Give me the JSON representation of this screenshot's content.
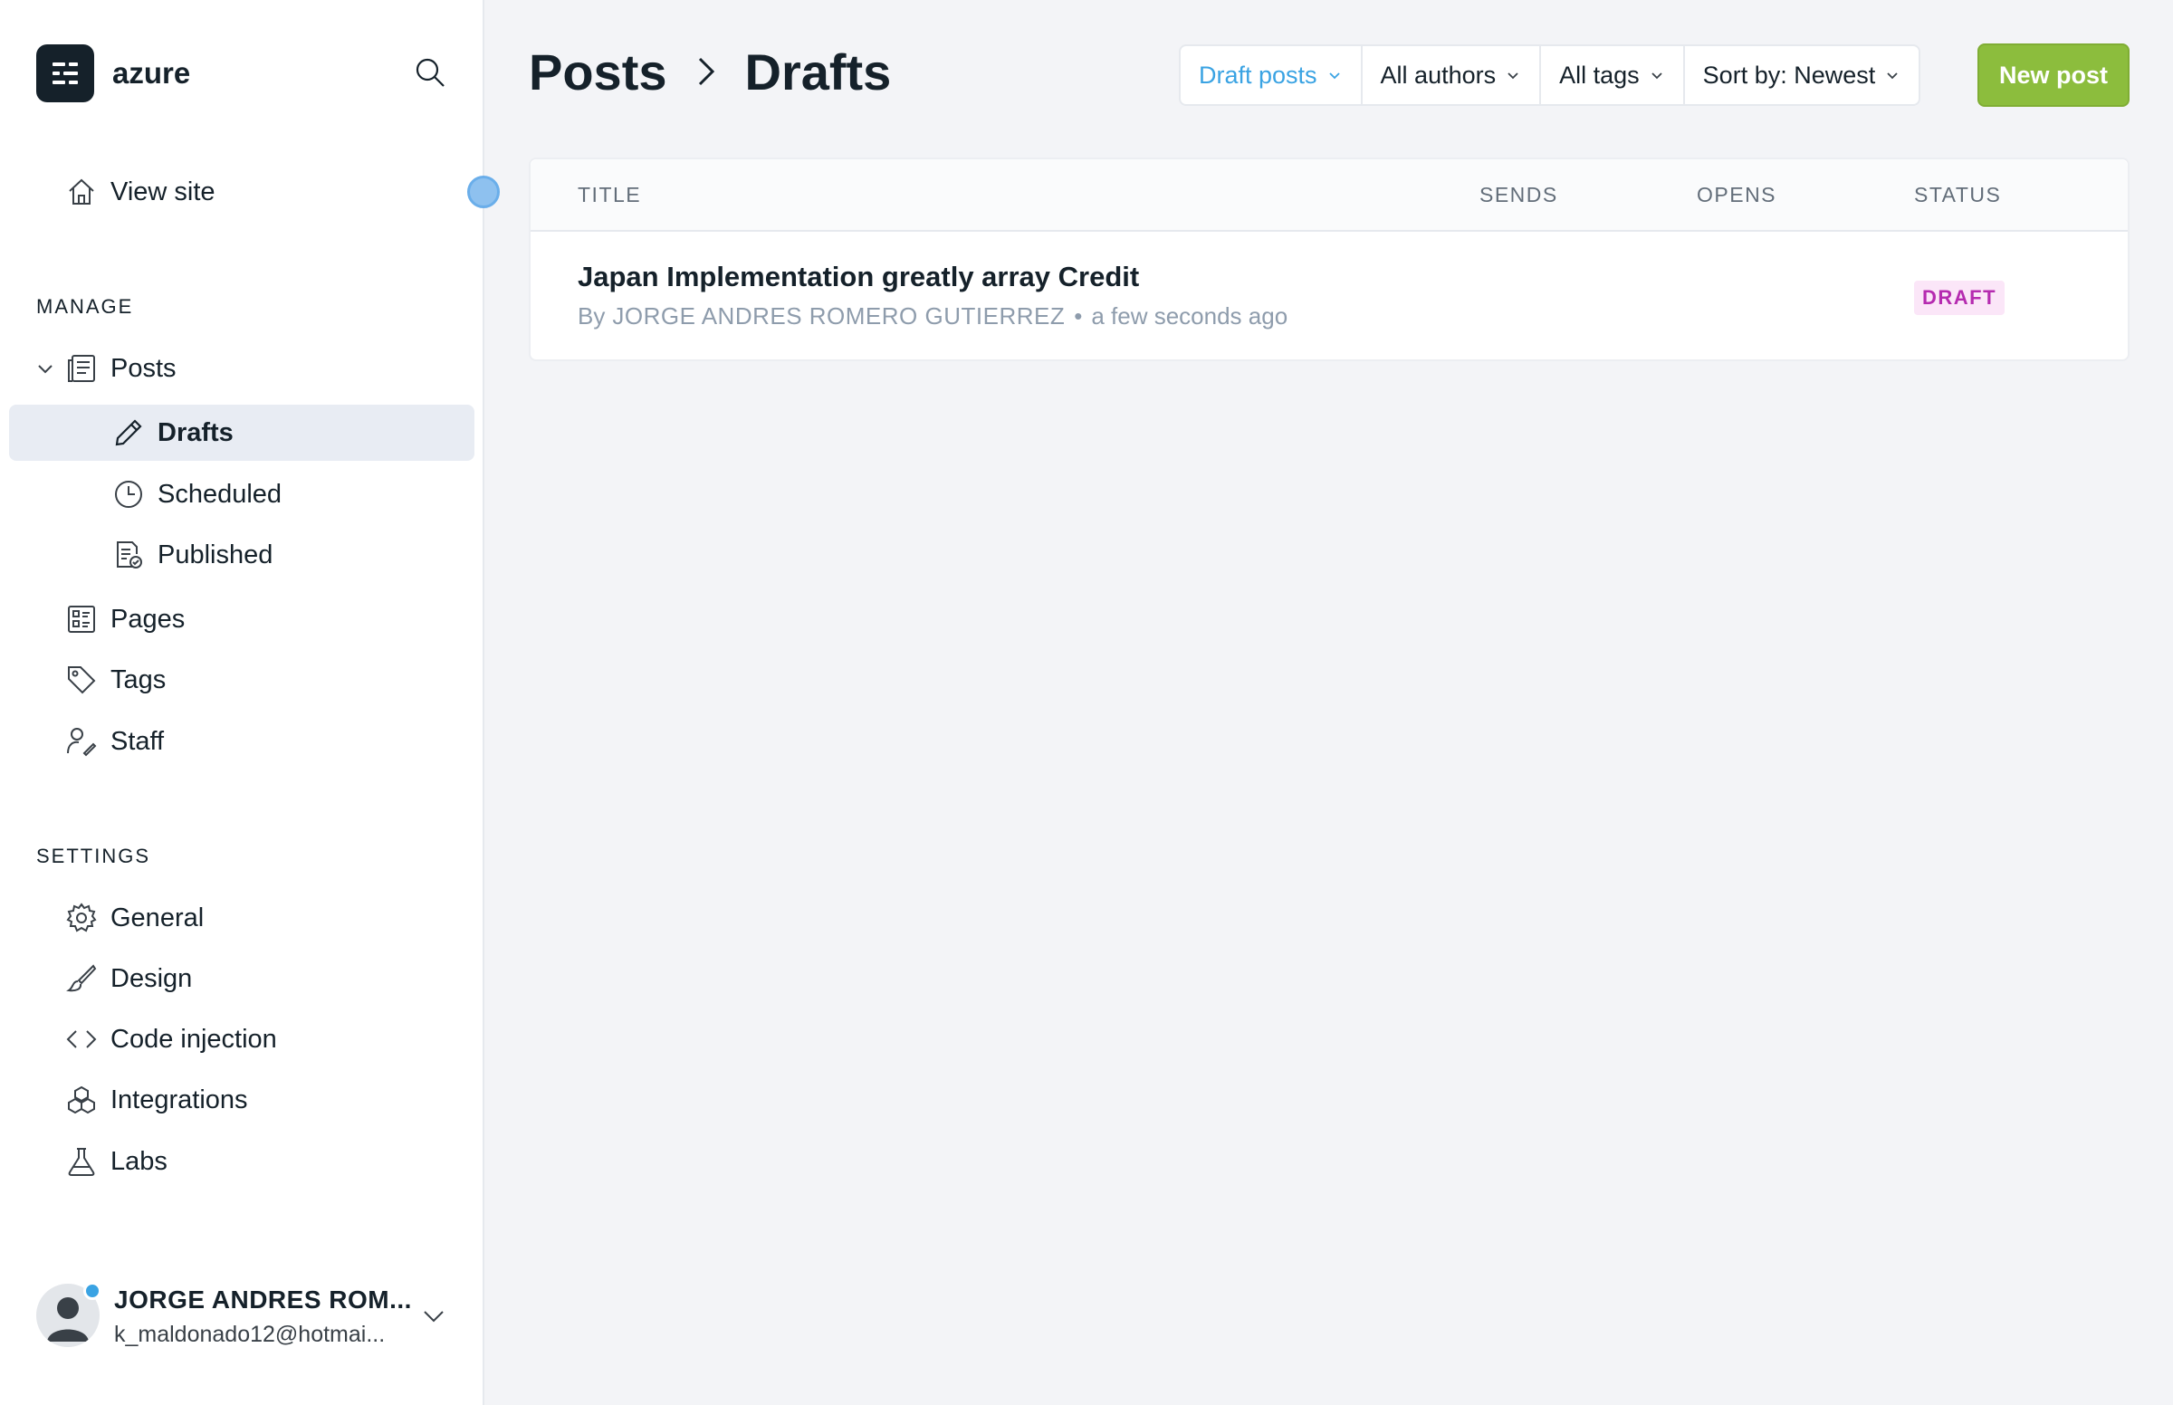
{
  "brand": {
    "name": "azure"
  },
  "nav": {
    "view_site": "View site",
    "manage_title": "MANAGE",
    "posts": "Posts",
    "drafts": "Drafts",
    "scheduled": "Scheduled",
    "published": "Published",
    "pages": "Pages",
    "tags": "Tags",
    "staff": "Staff",
    "settings_title": "SETTINGS",
    "general": "General",
    "design": "Design",
    "code_injection": "Code injection",
    "integrations": "Integrations",
    "labs": "Labs"
  },
  "user": {
    "name": "JORGE ANDRES ROM...",
    "email": "k_maldonado12@hotmai..."
  },
  "breadcrumb": {
    "parent": "Posts",
    "current": "Drafts"
  },
  "filters": {
    "type": "Draft posts",
    "authors": "All authors",
    "tags": "All tags",
    "sort": "Sort by: Newest"
  },
  "actions": {
    "new_post": "New post"
  },
  "table": {
    "headers": {
      "title": "TITLE",
      "sends": "SENDS",
      "opens": "OPENS",
      "status": "STATUS"
    },
    "rows": [
      {
        "title": "Japan Implementation greatly array Credit",
        "by": "By",
        "author": "JORGE ANDRES ROMERO GUTIERREZ",
        "separator": "•",
        "time": "a few seconds ago",
        "status": "DRAFT"
      }
    ]
  },
  "colors": {
    "accent": "#3aa3e3",
    "primary_button": "#8cbd3d",
    "draft_badge_bg": "#fbe6f8",
    "draft_badge_text": "#b52bb0"
  }
}
